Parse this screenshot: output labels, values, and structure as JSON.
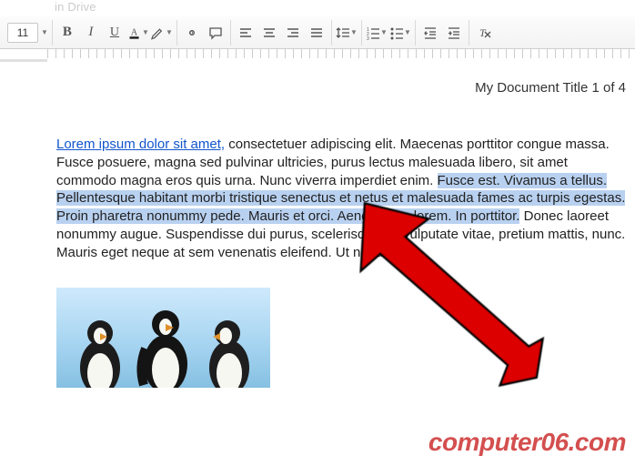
{
  "window": {
    "title_fragment": "in Drive"
  },
  "toolbar": {
    "font_size": "11",
    "bold": "B",
    "italic": "I",
    "underline": "U"
  },
  "document": {
    "header": "My Document Title 1 of 4",
    "link_text": "Lorem ipsum dolor sit amet,",
    "plain_1": " consectetuer adipiscing elit. Maecenas porttitor congue massa. Fusce posuere, magna sed pulvinar ultricies, purus lectus malesuada libero, sit amet commodo magna eros quis urna. Nunc viverra imperdiet enim. ",
    "selected": "Fusce est. Vivamus a tellus. Pellentesque habitant morbi tristique senectus et netus et malesuada fames ac turpis egestas. Proin pharetra nonummy pede. Mauris et orci. Aenean nec lorem. In porttitor.",
    "plain_2": " Donec laoreet nonummy augue. Suspendisse dui purus, scelerisque at, vulputate vitae, pretium mattis, nunc. Mauris eget neque at sem venenatis eleifend. Ut nonummy."
  },
  "watermark": "computer06.com",
  "colors": {
    "link": "#1155cc",
    "selection": "#b9d1f0",
    "arrow": "#dd0000",
    "arrow_stroke": "#000000"
  }
}
